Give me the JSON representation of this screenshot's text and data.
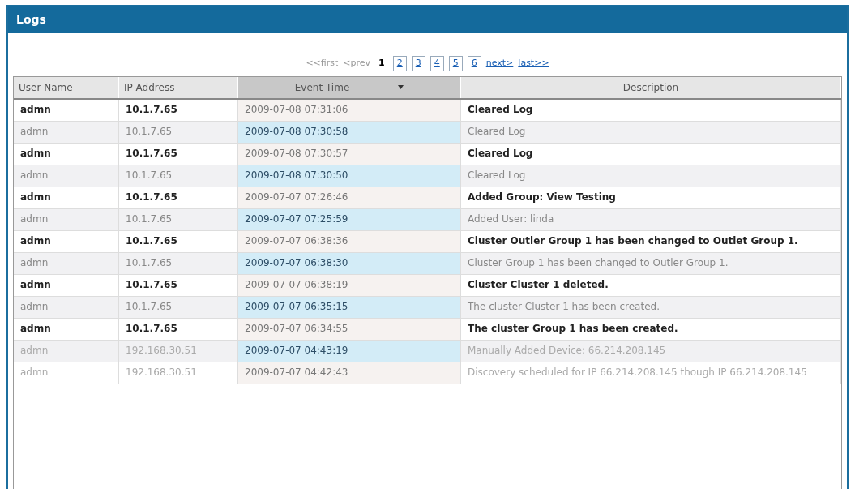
{
  "window": {
    "title": "Logs"
  },
  "pager": {
    "first": "<<first",
    "prev": "<prev",
    "pages": [
      {
        "label": "1",
        "selected": true
      },
      {
        "label": "2",
        "selected": false
      },
      {
        "label": "3",
        "selected": false
      },
      {
        "label": "4",
        "selected": false
      },
      {
        "label": "5",
        "selected": false
      },
      {
        "label": "6",
        "selected": false
      }
    ],
    "next": "next>",
    "last": "last>>"
  },
  "table": {
    "columns": [
      {
        "label": "User Name",
        "sorted": false
      },
      {
        "label": "IP Address",
        "sorted": false
      },
      {
        "label": "Event Time",
        "sorted": true
      },
      {
        "label": "Description",
        "sorted": false
      }
    ],
    "rows": [
      [
        "admn",
        "10.1.7.65",
        "2009-07-08 07:31:06",
        "Cleared Log"
      ],
      [
        "admn",
        "10.1.7.65",
        "2009-07-08 07:30:58",
        "Cleared Log"
      ],
      [
        "admn",
        "10.1.7.65",
        "2009-07-08 07:30:57",
        "Cleared Log"
      ],
      [
        "admn",
        "10.1.7.65",
        "2009-07-08 07:30:50",
        "Cleared Log"
      ],
      [
        "admn",
        "10.1.7.65",
        "2009-07-07 07:26:46",
        "Added Group: View Testing"
      ],
      [
        "admn",
        "10.1.7.65",
        "2009-07-07 07:25:59",
        "Added User: linda"
      ],
      [
        "admn",
        "10.1.7.65",
        "2009-07-07 06:38:36",
        "Cluster Outler Group 1 has been changed to Outlet Group 1."
      ],
      [
        "admn",
        "10.1.7.65",
        "2009-07-07 06:38:30",
        "Cluster Group 1 has been changed to Outler Group 1."
      ],
      [
        "admn",
        "10.1.7.65",
        "2009-07-07 06:38:19",
        "Cluster Cluster 1 deleted."
      ],
      [
        "admn",
        "10.1.7.65",
        "2009-07-07 06:35:15",
        "The cluster Cluster 1 has been created."
      ],
      [
        "admn",
        "10.1.7.65",
        "2009-07-07 06:34:55",
        "The cluster Group 1 has been created."
      ],
      [
        "admn",
        "192.168.30.51",
        "2009-07-07 04:43:19",
        "Manually Added Device: 66.214.208.145"
      ],
      [
        "admn",
        "192.168.30.51",
        "2009-07-07 04:42:43",
        "Discovery scheduled for IP 66.214.208.145 though IP 66.214.208.145"
      ]
    ]
  }
}
